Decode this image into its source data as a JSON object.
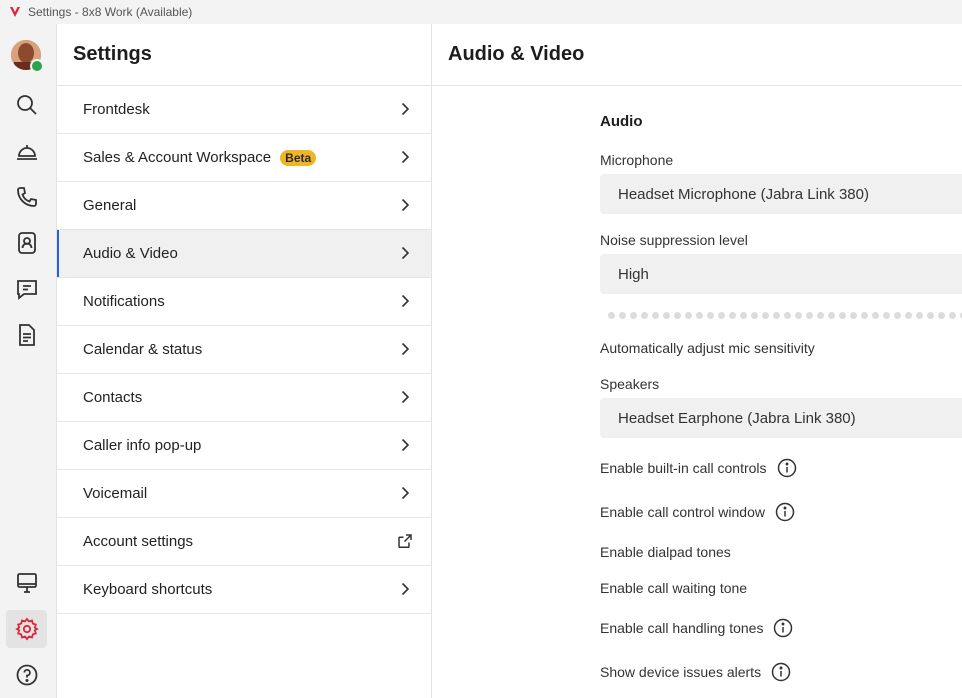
{
  "window": {
    "title": "Settings - 8x8 Work (Available)"
  },
  "rail": {
    "icons": [
      "user-avatar",
      "search-icon",
      "frontdesk-bell-icon",
      "phone-icon",
      "contacts-icon",
      "chat-icon",
      "document-icon",
      "monitor-icon",
      "gear-icon",
      "help-icon"
    ],
    "status_color": "#2aa44f"
  },
  "settings": {
    "title": "Settings",
    "items": [
      {
        "label": "Frontdesk"
      },
      {
        "label": "Sales & Account Workspace",
        "badge": "Beta"
      },
      {
        "label": "General"
      },
      {
        "label": "Audio & Video"
      },
      {
        "label": "Notifications"
      },
      {
        "label": "Calendar & status"
      },
      {
        "label": "Contacts"
      },
      {
        "label": "Caller info pop-up"
      },
      {
        "label": "Voicemail"
      },
      {
        "label": "Account settings"
      },
      {
        "label": "Keyboard shortcuts"
      }
    ],
    "active_item": "Audio & Video",
    "accent_color": "#2563c9",
    "badge_color": "#f0b429"
  },
  "content": {
    "title": "Audio & Video",
    "audio": {
      "section_title": "Audio",
      "microphone_label": "Microphone",
      "microphone_value": "Headset Microphone (Jabra Link 380)",
      "noise_label": "Noise suppression level",
      "noise_value": "High",
      "auto_adjust_label": "Automatically adjust mic sensitivity",
      "speakers_label": "Speakers",
      "speakers_value": "Headset Earphone (Jabra Link 380)",
      "builtin_controls_label": "Enable built-in call controls",
      "control_window_label": "Enable call control window",
      "dialpad_tones_label": "Enable dialpad tones",
      "waiting_tone_label": "Enable call waiting tone",
      "handling_tones_label": "Enable call handling tones",
      "device_alerts_label": "Show device issues alerts"
    }
  }
}
